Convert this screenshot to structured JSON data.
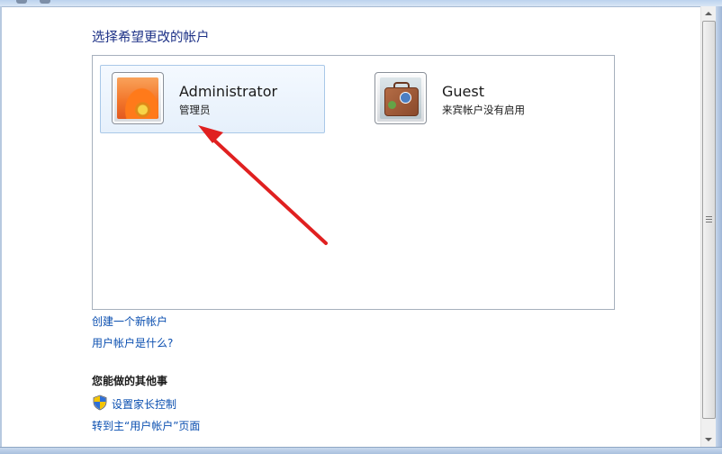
{
  "heading": "选择希望更改的帐户",
  "accounts": [
    {
      "name": "Administrator",
      "subtitle": "管理员",
      "avatar": "orange-flower-avatar",
      "selected": true
    },
    {
      "name": "Guest",
      "subtitle": "来宾帐户没有启用",
      "avatar": "suitcase-avatar",
      "selected": false
    }
  ],
  "links": {
    "create_account": "创建一个新帐户",
    "what_is_account": "用户帐户是什么?"
  },
  "other_tasks": {
    "title": "您能做的其他事",
    "parental_controls": "设置家长控制",
    "main_page": "转到主“用户帐户”页面"
  },
  "colors": {
    "heading": "#1e3287",
    "link": "#0b4fb0",
    "annotation_arrow": "#e02020"
  }
}
